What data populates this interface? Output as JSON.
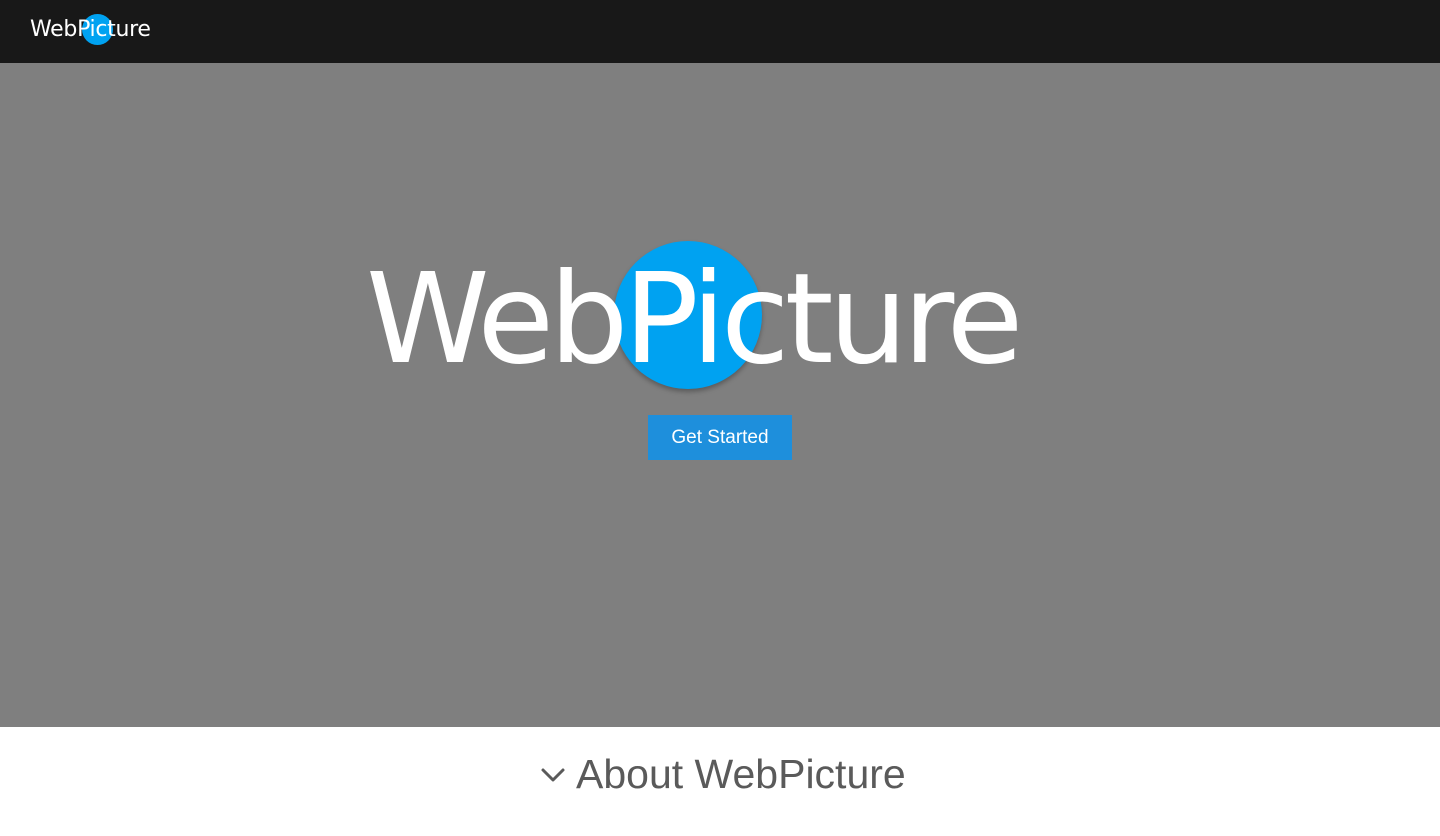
{
  "navbar": {
    "logo": {
      "text": "WebPicture",
      "accent_color": "#00a2f1"
    }
  },
  "hero": {
    "logo": {
      "text": "WebPicture",
      "accent_color": "#00a2f1"
    },
    "cta_label": "Get Started",
    "background_color": "#7f7f7f"
  },
  "about": {
    "label": "About WebPicture",
    "icon": "chevron-down-icon"
  },
  "colors": {
    "navbar_bg": "#181818",
    "button_bg": "#1e8fdc",
    "about_text": "#5a5a5a"
  }
}
